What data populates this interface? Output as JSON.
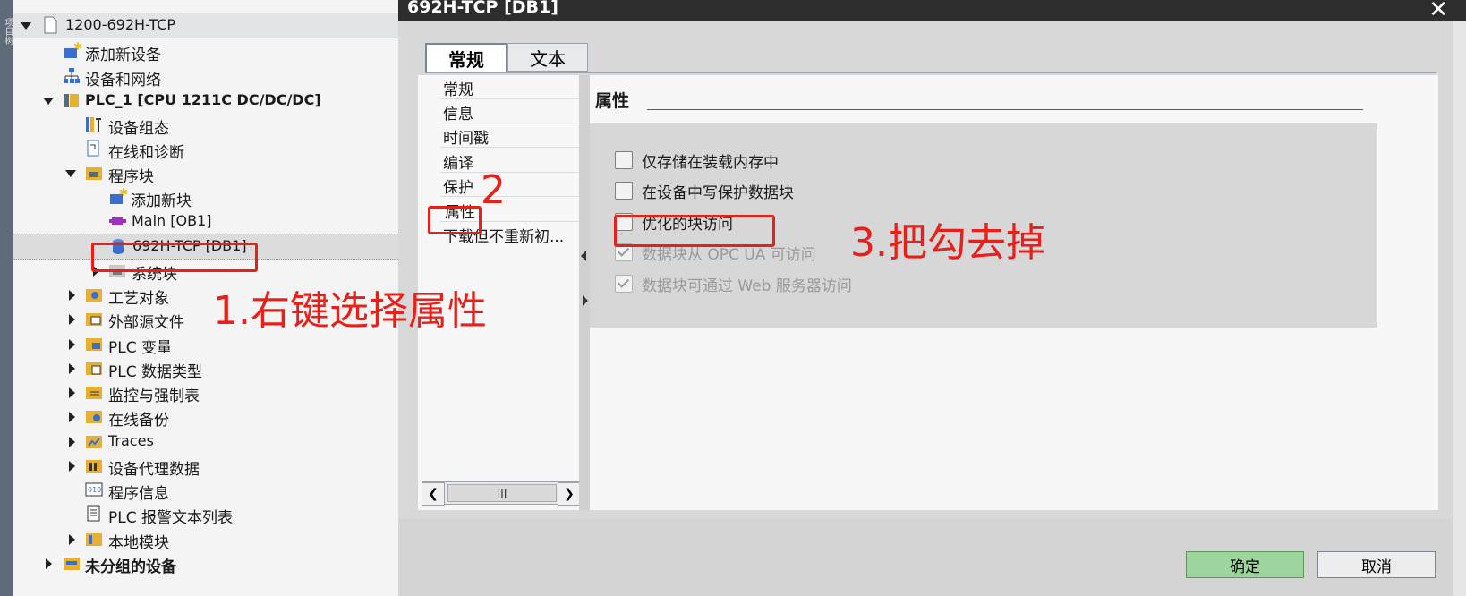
{
  "left_strip": {
    "text": "项目树"
  },
  "tree": {
    "items": [
      {
        "label": "1200-692H-TCP"
      },
      {
        "label": "添加新设备"
      },
      {
        "label": "设备和网络"
      },
      {
        "label": "PLC_1 [CPU 1211C DC/DC/DC]"
      },
      {
        "label": "设备组态"
      },
      {
        "label": "在线和诊断"
      },
      {
        "label": "程序块"
      },
      {
        "label": "添加新块"
      },
      {
        "label": "Main [OB1]"
      },
      {
        "label": "692H-TCP [DB1]"
      },
      {
        "label": "系统块"
      },
      {
        "label": "工艺对象"
      },
      {
        "label": "外部源文件"
      },
      {
        "label": "PLC 变量"
      },
      {
        "label": "PLC 数据类型"
      },
      {
        "label": "监控与强制表"
      },
      {
        "label": "在线备份"
      },
      {
        "label": "Traces"
      },
      {
        "label": "设备代理数据"
      },
      {
        "label": "程序信息"
      },
      {
        "label": "PLC 报警文本列表"
      },
      {
        "label": "本地模块"
      },
      {
        "label": "未分组的设备"
      }
    ]
  },
  "dialog": {
    "title": "692H-TCP [DB1]",
    "close": "✕",
    "tabs": [
      {
        "label": "常规"
      },
      {
        "label": "文本"
      }
    ],
    "nav": [
      {
        "label": "常规"
      },
      {
        "label": "信息"
      },
      {
        "label": "时间戳"
      },
      {
        "label": "编译"
      },
      {
        "label": "保护"
      },
      {
        "label": "属性"
      },
      {
        "label": "下载但不重新初..."
      }
    ],
    "section_title": "属性",
    "options": [
      {
        "label": "仅存储在装载内存中",
        "checked": false,
        "enabled": true
      },
      {
        "label": "在设备中写保护数据块",
        "checked": false,
        "enabled": true
      },
      {
        "label": "优化的块访问",
        "checked": false,
        "enabled": true
      },
      {
        "label": "数据块从 OPC UA 可访问",
        "checked": true,
        "enabled": false
      },
      {
        "label": "数据块可通过 Web 服务器访问",
        "checked": true,
        "enabled": false
      }
    ],
    "ok_label": "确定",
    "cancel_label": "取消"
  },
  "annotations": {
    "step1": "1.右键选择属性",
    "step2": "2",
    "step3": "3.把勾去掉"
  },
  "colors": {
    "annotation": "#e8201a",
    "ok_button": "#9ed59e",
    "titlebar": "#2d2d2d"
  }
}
